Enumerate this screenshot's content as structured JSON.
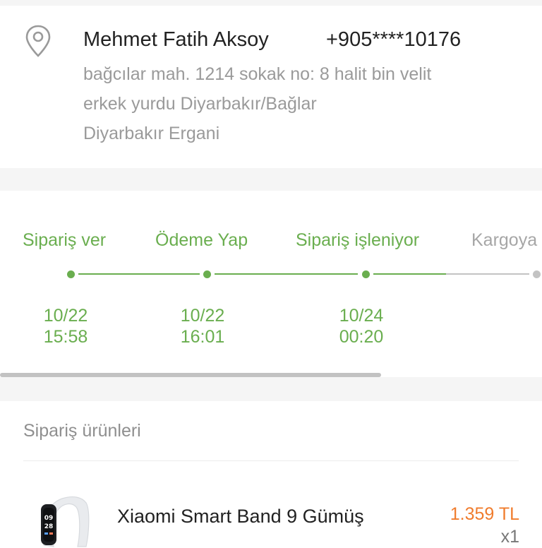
{
  "address": {
    "name": "Mehmet Fatih Aksoy",
    "phone": "+905****10176",
    "lines": [
      "bağcılar mah. 1214 sokak no: 8 halit bin velit",
      "erkek yurdu Diyarbakır/Bağlar",
      "Diyarbakır Ergani"
    ],
    "icon": "location-pin-icon"
  },
  "progress": {
    "steps": [
      {
        "label": "Sipariş ver",
        "date": "10/22",
        "time": "15:58",
        "status": "done"
      },
      {
        "label": "Ödeme Yap",
        "date": "10/22",
        "time": "16:01",
        "status": "done"
      },
      {
        "label": "Sipariş işleniyor",
        "date": "10/24",
        "time": "00:20",
        "status": "done"
      },
      {
        "label": "Kargoya",
        "date": "",
        "time": "",
        "status": "pending"
      }
    ]
  },
  "products": {
    "title": "Sipariş ürünleri",
    "items": [
      {
        "name": "Xiaomi Smart Band 9 Gümüş",
        "price": "1.359 TL",
        "qty": "x1",
        "thumb_time_top": "09",
        "thumb_time_bottom": "28"
      }
    ]
  },
  "colors": {
    "accent_green": "#6aae4f",
    "price_orange": "#f07c2d",
    "muted_gray": "#9a9a9a"
  }
}
